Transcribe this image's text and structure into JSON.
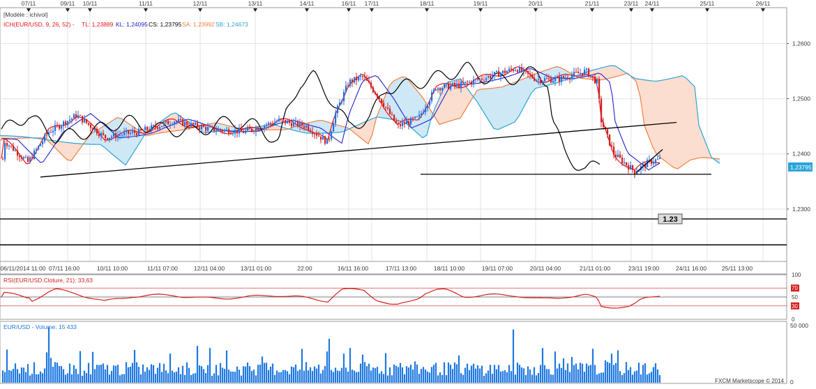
{
  "colors": {
    "background": "#ffffff",
    "grid": "#e3e3e3",
    "candle_up": "#1f6fe0",
    "candle_down": "#d21f1f",
    "tenkan": "#e8141a",
    "kijun": "#2222cc",
    "chikou": "#000000",
    "senkou_a": "#f08040",
    "senkou_b": "#2aa4d8",
    "cloud_bull": "#cfe8f6",
    "cloud_bear": "#fcded0",
    "rsi": "#d21f1f",
    "volume": "#1f78e0",
    "price_tag_bg": "#2aa4d8",
    "label_bg": "#dcdcdc"
  },
  "header": {
    "model": "[Modèle : ichivol]",
    "indicator": "ICH(EUR/USD, 9, 26, 52) -",
    "tl": "TL: 1,23889",
    "kl": "KL: 1,24095",
    "cs": "CS: 1,23795",
    "sa": "SA: 1,23992",
    "sb": "SB: 1,24673"
  },
  "top_dates": [
    "07/11",
    "09/11",
    "10/11",
    "11/11",
    "12/11",
    "13/11",
    "14/11",
    "16/11",
    "17/11",
    "18/11",
    "19/11",
    "20/11",
    "21/11",
    "23/11",
    "24/11",
    "25/11",
    "26/11"
  ],
  "bottom_dates": [
    "06/11/2014 11:00",
    "07/11 16:00",
    "10/11 10:00",
    "11/11 07:00",
    "12/11 04:00",
    "13/11 01:00",
    "22:00",
    "16/11 16:00",
    "17/11 13:00",
    "18/11 10:00",
    "19/11 07:00",
    "20/11 04:00",
    "21/11 01:00",
    "23/11 19:00",
    "24/11 16:00",
    "25/11 13:00"
  ],
  "price_axis": {
    "labels": [
      "1,2600",
      "1,2500",
      "1,2400",
      "1,2300"
    ],
    "values": [
      1.26,
      1.25,
      1.24,
      1.23
    ],
    "min": 1.2205,
    "max": 1.2665,
    "current": "1,23795",
    "current_value": 1.23795
  },
  "annotation": {
    "text": "1.23"
  },
  "rsi": {
    "title": "RSI(EUR/USD.Cloture, 21): 33,63",
    "levels": [
      "100",
      "70",
      "50",
      "30",
      "0"
    ]
  },
  "volume": {
    "title": "EUR/USD - Volume: 15 433",
    "axis": [
      "50 000",
      "0"
    ]
  },
  "footer": "FXCM Marketscope © 2014",
  "chart_data": {
    "type": "candlestick",
    "symbol": "EUR/USD",
    "title": "ICH(EUR/USD, 9, 26, 52)",
    "ylim": [
      1.2205,
      1.2665
    ],
    "series": [
      {
        "name": "EUR/USD",
        "close": [
          1.2398,
          1.239,
          1.238,
          1.2375,
          1.2385,
          1.2395,
          1.242,
          1.244,
          1.246,
          1.245,
          1.247,
          1.248,
          1.2475,
          1.246,
          1.244,
          1.2445,
          1.245,
          1.2455,
          1.247,
          1.248,
          1.2475,
          1.246,
          1.244,
          1.246,
          1.249,
          1.251,
          1.252,
          1.2525,
          1.253,
          1.254,
          1.255,
          1.2545,
          1.252,
          1.249,
          1.247,
          1.2455,
          1.244,
          1.242,
          1.2405,
          1.239,
          1.238,
          1.2379
        ],
        "note": "approximate closes across 06/11/2014 – 24/11/2014 read from candles"
      },
      {
        "name": "TL",
        "last": 1.23889
      },
      {
        "name": "KL",
        "last": 1.24095
      },
      {
        "name": "CS",
        "last": 1.23795
      },
      {
        "name": "SA",
        "last": 1.23992
      },
      {
        "name": "SB",
        "last": 1.24673
      }
    ],
    "horizontal_lines": [
      1.2363,
      1.2282,
      1.2235
    ],
    "rsi_last": 33.63,
    "rsi_levels": [
      70,
      50,
      30
    ],
    "volume_last": 15433,
    "volume_max": 50000
  }
}
